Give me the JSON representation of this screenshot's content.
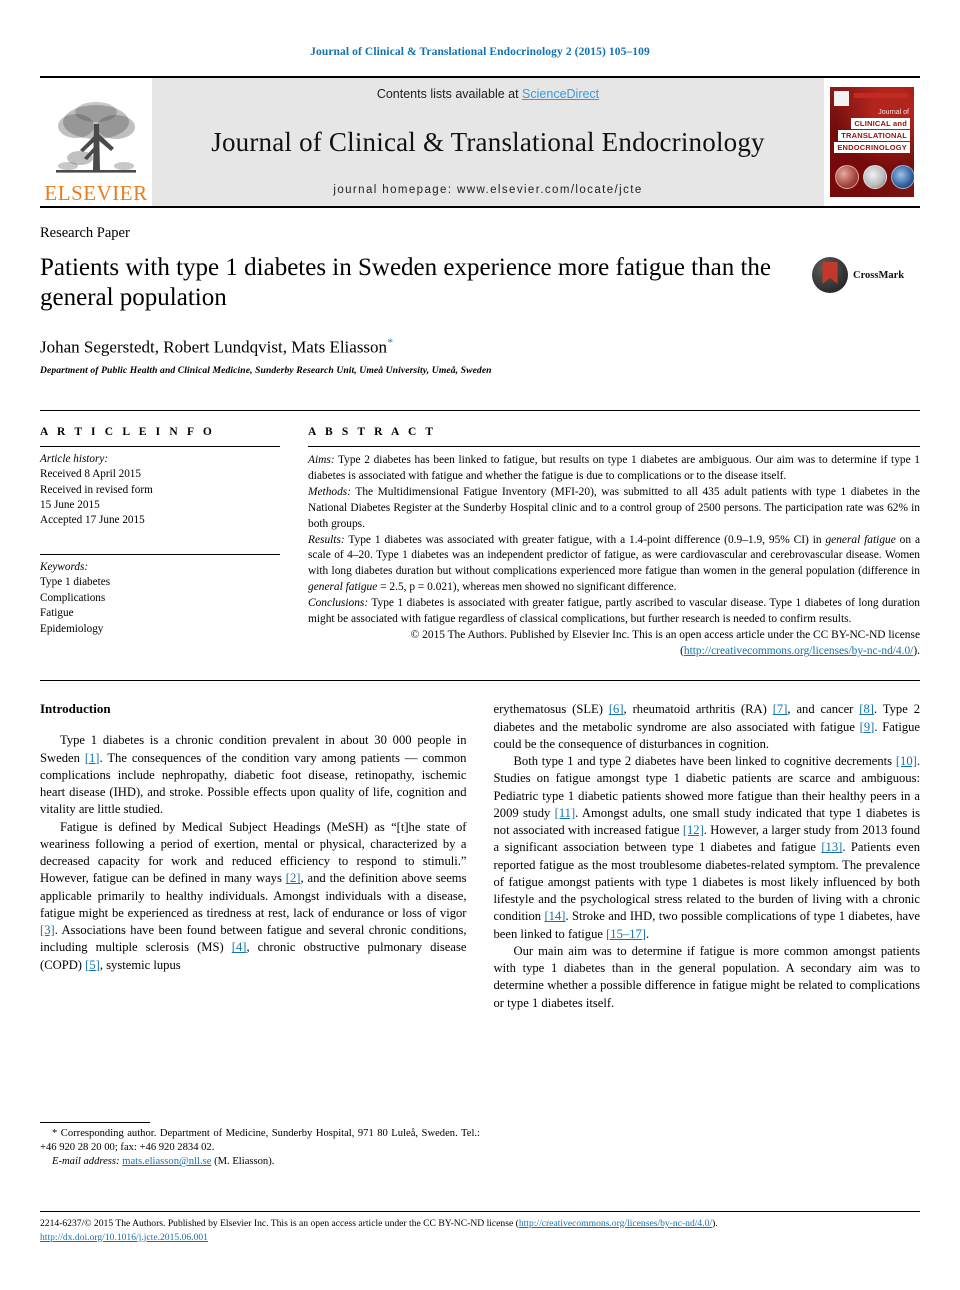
{
  "running_head": "Journal of Clinical & Translational Endocrinology 2 (2015) 105–109",
  "masthead": {
    "publisher": "ELSEVIER",
    "publisher_logo_icon": "elsevier-tree-icon",
    "contents_prefix": "Contents lists available at ",
    "sciencedirect": "ScienceDirect",
    "journal_title": "Journal of Clinical & Translational Endocrinology",
    "homepage": "journal homepage: www.elsevier.com/locate/jcte",
    "cover": {
      "line_journal_of": "Journal of",
      "line1": "CLINICAL and",
      "line2": "TRANSLATIONAL",
      "line3": "ENDOCRINOLOGY"
    }
  },
  "article": {
    "kicker": "Research Paper",
    "title": "Patients with type 1 diabetes in Sweden experience more fatigue than the general population",
    "crossmark_label": "CrossMark",
    "authors": "Johan Segerstedt, Robert Lundqvist, Mats Eliasson",
    "corresponding_marker": "*",
    "affiliation": "Department of Public Health and Clinical Medicine, Sunderby Research Unit, Umeå University, Umeå, Sweden"
  },
  "article_info": {
    "heading": "A R T I C L E  I N F O",
    "history_label": "Article history:",
    "history": [
      "Received 8 April 2015",
      "Received in revised form",
      "15 June 2015",
      "Accepted 17 June 2015"
    ],
    "keywords_label": "Keywords:",
    "keywords": [
      "Type 1 diabetes",
      "Complications",
      "Fatigue",
      "Epidemiology"
    ]
  },
  "abstract": {
    "heading": "A B S T R A C T",
    "aims_label": "Aims:",
    "aims_text": " Type 2 diabetes has been linked to fatigue, but results on type 1 diabetes are ambiguous. Our aim was to determine if type 1 diabetes is associated with fatigue and whether the fatigue is due to complications or to the disease itself.",
    "methods_label": "Methods:",
    "methods_text": " The Multidimensional Fatigue Inventory (MFI-20), was submitted to all 435 adult patients with type 1 diabetes in the National Diabetes Register at the Sunderby Hospital clinic and to a control group of 2500 persons. The participation rate was 62% in both groups.",
    "results_label": "Results:",
    "results_part1": " Type 1 diabetes was associated with greater fatigue, with a 1.4-point difference (0.9–1.9, 95% CI) in ",
    "results_em1": "general fatigue",
    "results_part2": " on a scale of 4–20. Type 1 diabetes was an independent predictor of fatigue, as were cardiovascular and cerebrovascular disease. Women with long diabetes duration but without complications experienced more fatigue than women in the general population (difference in ",
    "results_em2": "general fatigue",
    "results_part3": " = 2.5, p = 0.021), whereas men showed no significant difference.",
    "conclusions_label": "Conclusions:",
    "conclusions_text": " Type 1 diabetes is associated with greater fatigue, partly ascribed to vascular disease. Type 1 diabetes of long duration might be associated with fatigue regardless of classical complications, but further research is needed to confirm results.",
    "copyright_text": "© 2015 The Authors. Published by Elsevier Inc. This is an open access article under the CC BY-NC-ND license (",
    "copyright_link": "http://creativecommons.org/licenses/by-nc-nd/4.0/",
    "copyright_tail": ")."
  },
  "introduction": {
    "heading": "Introduction",
    "left": {
      "p1_a": "Type 1 diabetes is a chronic condition prevalent in about 30 000 people in Sweden ",
      "p1_ref1": "[1]",
      "p1_b": ". The consequences of the condition vary among patients — common complications include nephropathy, diabetic foot disease, retinopathy, ischemic heart disease (IHD), and stroke. Possible effects upon quality of life, cognition and vitality are little studied.",
      "p2_a": "Fatigue is defined by Medical Subject Headings (MeSH) as “[t]he state of weariness following a period of exertion, mental or physical, characterized by a decreased capacity for work and reduced efficiency to respond to stimuli.” However, fatigue can be defined in many ways ",
      "p2_ref1": "[2]",
      "p2_b": ", and the definition above seems applicable primarily to healthy individuals. Amongst individuals with a disease, fatigue might be experienced as tiredness at rest, lack of endurance or loss of vigor ",
      "p2_ref2": "[3]",
      "p2_c": ". Associations have been found between fatigue and several chronic conditions, including multiple sclerosis (MS) ",
      "p2_ref3": "[4]",
      "p2_d": ", chronic obstructive pulmonary disease (COPD) ",
      "p2_ref4": "[5]",
      "p2_e": ", systemic lupus"
    },
    "right": {
      "p2_cont_a": "erythematosus (SLE) ",
      "p2_cont_ref1": "[6]",
      "p2_cont_b": ", rheumatoid arthritis (RA) ",
      "p2_cont_ref2": "[7]",
      "p2_cont_c": ", and cancer ",
      "p2_cont_ref3": "[8]",
      "p2_cont_d": ". Type 2 diabetes and the metabolic syndrome are also associated with fatigue ",
      "p2_cont_ref4": "[9]",
      "p2_cont_e": ". Fatigue could be the consequence of disturbances in cognition.",
      "p3_a": "Both type 1 and type 2 diabetes have been linked to cognitive decrements ",
      "p3_ref1": "[10]",
      "p3_b": ". Studies on fatigue amongst type 1 diabetic patients are scarce and ambiguous: Pediatric type 1 diabetic patients showed more fatigue than their healthy peers in a 2009 study ",
      "p3_ref2": "[11]",
      "p3_c": ". Amongst adults, one small study indicated that type 1 diabetes is not associated with increased fatigue ",
      "p3_ref3": "[12]",
      "p3_d": ". However, a larger study from 2013 found a significant association between type 1 diabetes and fatigue ",
      "p3_ref4": "[13]",
      "p3_e": ". Patients even reported fatigue as the most troublesome diabetes-related symptom. The prevalence of fatigue amongst patients with type 1 diabetes is most likely influenced by both lifestyle and the psychological stress related to the burden of living with a chronic condition ",
      "p3_ref5": "[14]",
      "p3_f": ". Stroke and IHD, two possible complications of type 1 diabetes, have been linked to fatigue ",
      "p3_ref6": "[15–17]",
      "p3_g": ".",
      "p4": "Our main aim was to determine if fatigue is more common amongst patients with type 1 diabetes than in the general population. A secondary aim was to determine whether a possible difference in fatigue might be related to complications or type 1 diabetes itself."
    }
  },
  "footnotes": {
    "corresponding": "* Corresponding author. Department of Medicine, Sunderby Hospital, 971 80 Luleå, Sweden. Tel.: +46 920 28 20 00; fax: +46 920 2834 02.",
    "email_label": "E-mail address:",
    "email": "mats.eliasson@nll.se",
    "email_tail": " (M. Eliasson)."
  },
  "bottom": {
    "issn_line_a": "2214-6237/© 2015 The Authors. Published by Elsevier Inc. This is an open access article under the CC BY-NC-ND license (",
    "issn_link": "http://creativecommons.org/licenses/by-nc-nd/4.0/",
    "issn_line_b": ").",
    "doi": "http://dx.doi.org/10.1016/j.jcte.2015.06.001"
  },
  "colors": {
    "link_blue": "#1373b0",
    "sciencedirect_blue": "#3a9bd9",
    "elsevier_orange": "#e87d1e"
  }
}
